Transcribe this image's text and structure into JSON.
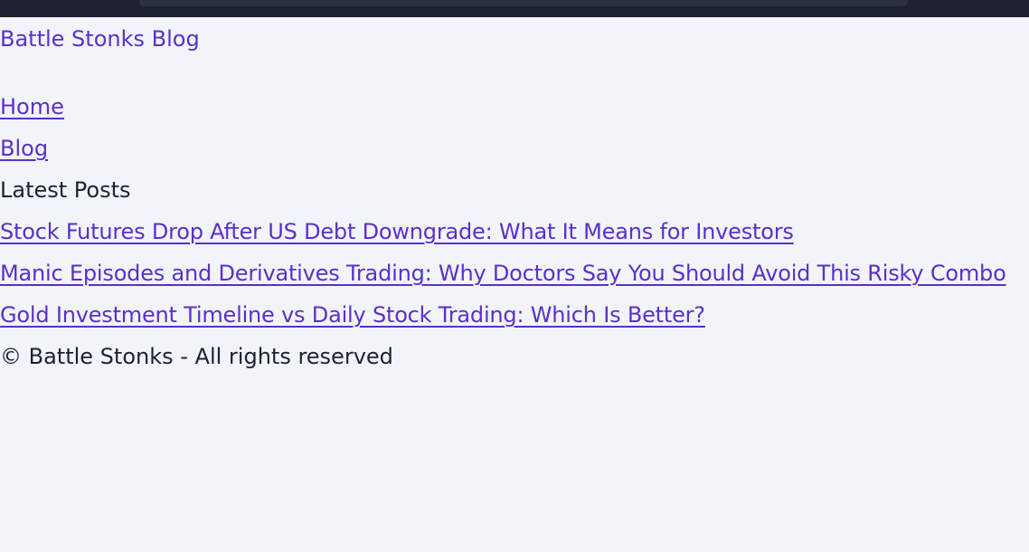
{
  "site": {
    "brand": "Battle Stonks Blog"
  },
  "nav": {
    "items": [
      {
        "label": "Home"
      },
      {
        "label": "Blog"
      }
    ]
  },
  "latest_posts": {
    "heading": "Latest Posts",
    "items": [
      {
        "title": "Stock Futures Drop After US Debt Downgrade: What It Means for Investors"
      },
      {
        "title": "Manic Episodes and Derivatives Trading: Why Doctors Say You Should Avoid This Risky Combo"
      },
      {
        "title": "Gold Investment Timeline vs Daily Stock Trading: Which Is Better?"
      }
    ]
  },
  "footer": {
    "text": "© Battle Stonks - All rights reserved"
  },
  "colors": {
    "link": "#5b30c8",
    "text": "#1c2233",
    "background": "#f1f4f8",
    "topbar": "#1e2230"
  }
}
